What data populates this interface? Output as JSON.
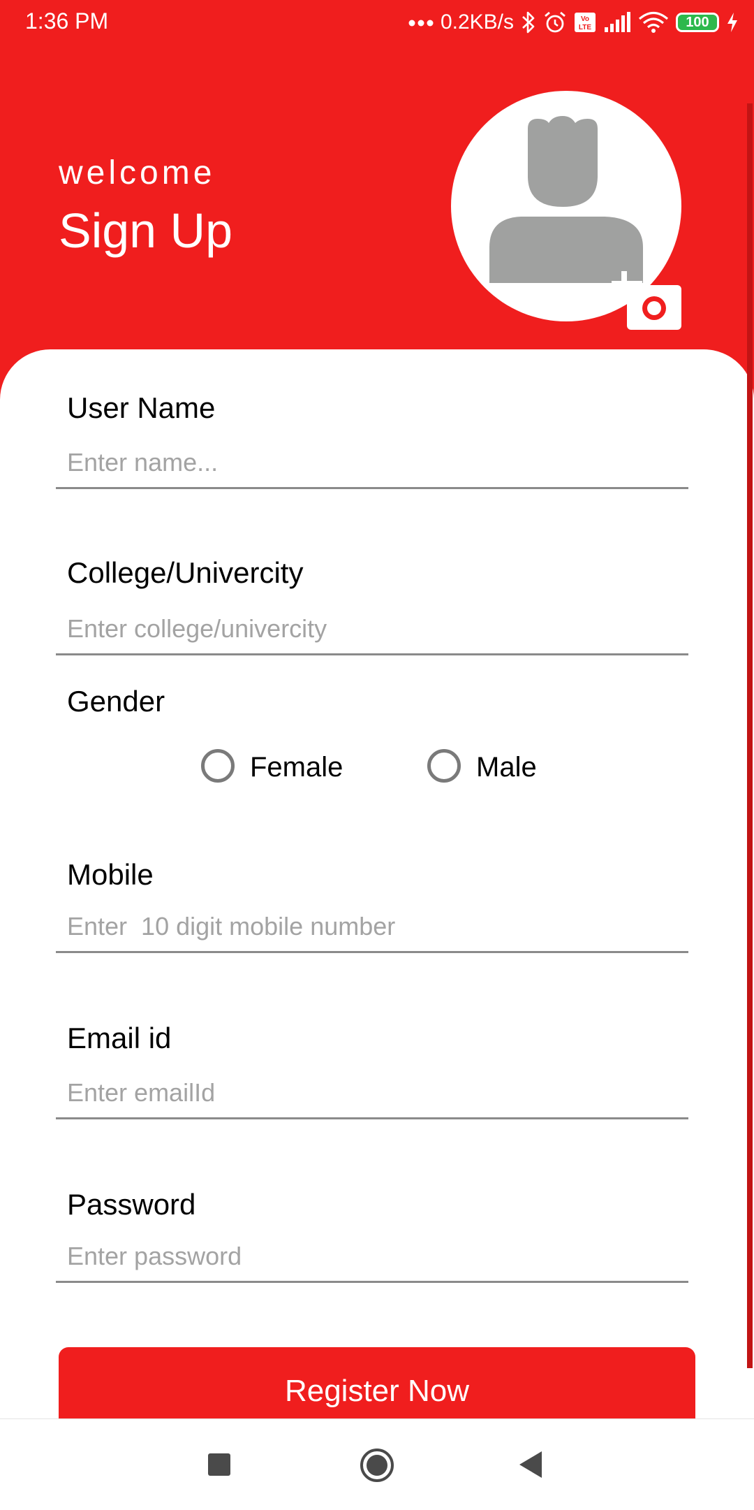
{
  "status_bar": {
    "time": "1:36 PM",
    "network_speed": "0.2KB/s",
    "battery": "100",
    "icons": [
      "dots-icon",
      "bluetooth-icon",
      "alarm-icon",
      "volte-icon",
      "signal-icon",
      "wifi-icon",
      "battery-icon",
      "charging-icon"
    ]
  },
  "header": {
    "welcome": "welcome",
    "title": "Sign Up",
    "avatar_icon": "user-placeholder-icon",
    "camera_icon": "camera-add-icon"
  },
  "form": {
    "username": {
      "label": "User Name",
      "placeholder": "Enter name..."
    },
    "college": {
      "label": "College/Univercity",
      "placeholder": "Enter college/univercity"
    },
    "gender": {
      "label": "Gender",
      "options": [
        "Female",
        "Male"
      ],
      "selected": null
    },
    "mobile": {
      "label": "Mobile",
      "placeholder": "Enter  10 digit mobile number"
    },
    "email": {
      "label": "Email id",
      "placeholder": "Enter emailId"
    },
    "password": {
      "label": "Password",
      "placeholder": "Enter password"
    },
    "register_label": "Register Now"
  },
  "navbar": {
    "icons": [
      "recents-icon",
      "home-icon",
      "back-icon"
    ]
  },
  "colors": {
    "accent": "#f01e1e",
    "avatar_gray": "#a0a1a0",
    "placeholder": "#a3a3a3"
  }
}
